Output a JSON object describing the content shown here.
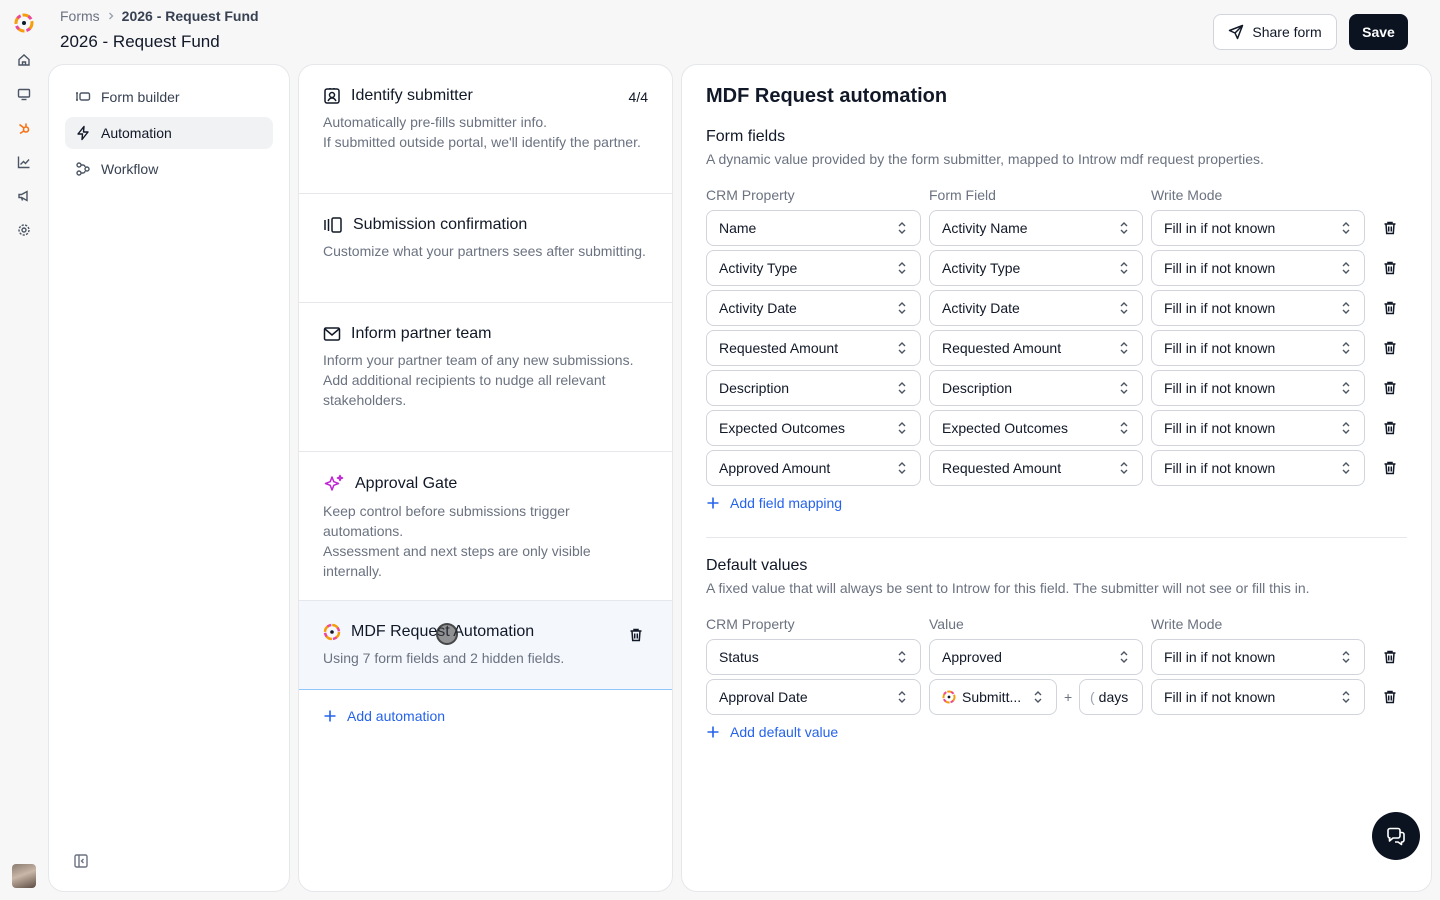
{
  "header": {
    "breadcrumb_root": "Forms",
    "breadcrumb_current": "2026 - Request Fund",
    "page_title": "2026 - Request Fund",
    "share_label": "Share form",
    "save_label": "Save"
  },
  "nav": {
    "items": [
      {
        "label": "Form builder",
        "icon": "form-builder-icon",
        "active": false
      },
      {
        "label": "Automation",
        "icon": "lightning-icon",
        "active": true
      },
      {
        "label": "Workflow",
        "icon": "workflow-icon",
        "active": false
      }
    ]
  },
  "automations": {
    "identify": {
      "title": "Identify submitter",
      "count": "4/4",
      "desc1": "Automatically pre-fills submitter info.",
      "desc2": "If submitted outside portal, we'll identify the partner."
    },
    "confirmation": {
      "title": "Submission confirmation",
      "desc1": "Customize what your partners sees after submitting."
    },
    "inform": {
      "title": "Inform partner team",
      "desc1": "Inform your partner team of any new submissions.",
      "desc2": "Add additional recipients to nudge all relevant stakeholders."
    },
    "approval": {
      "title": "Approval Gate",
      "desc1": "Keep control before submissions trigger automations.",
      "desc2": "Assessment and next steps are only visible internally."
    },
    "mdf": {
      "title": "MDF Request Automation",
      "desc1": "Using 7 form fields and 2 hidden fields."
    },
    "add_label": "Add automation"
  },
  "main": {
    "title": "MDF Request automation",
    "form_fields": {
      "title": "Form fields",
      "desc": "A dynamic value provided by the form submitter, mapped to Introw mdf request properties.",
      "col_crm": "CRM Property",
      "col_field": "Form Field",
      "col_mode": "Write Mode",
      "rows": [
        {
          "crm": "Name",
          "field": "Activity Name",
          "mode": "Fill in if not known"
        },
        {
          "crm": "Activity Type",
          "field": "Activity Type",
          "mode": "Fill in if not known"
        },
        {
          "crm": "Activity Date",
          "field": "Activity Date",
          "mode": "Fill in if not known"
        },
        {
          "crm": "Requested Amount",
          "field": "Requested Amount",
          "mode": "Fill in if not known"
        },
        {
          "crm": "Description",
          "field": "Description",
          "mode": "Fill in if not known"
        },
        {
          "crm": "Expected Outcomes",
          "field": "Expected Outcomes",
          "mode": "Fill in if not known"
        },
        {
          "crm": "Approved Amount",
          "field": "Requested Amount",
          "mode": "Fill in if not known"
        }
      ],
      "add_label": "Add field mapping"
    },
    "defaults": {
      "title": "Default values",
      "desc": "A fixed value that will always be sent to Introw for this field. The submitter will not see or fill this in.",
      "col_crm": "CRM Property",
      "col_value": "Value",
      "col_mode": "Write Mode",
      "row1": {
        "crm": "Status",
        "value": "Approved",
        "mode": "Fill in if not known"
      },
      "row2": {
        "crm": "Approval Date",
        "value": "Submitt...",
        "plus": "+",
        "days_digit": "(",
        "days_label": "days",
        "mode": "Fill in if not known"
      },
      "add_label": "Add default value"
    }
  },
  "colors": {
    "accent": "#2563eb",
    "dark": "#0b1220",
    "selected_bg": "#f4f8fd"
  }
}
